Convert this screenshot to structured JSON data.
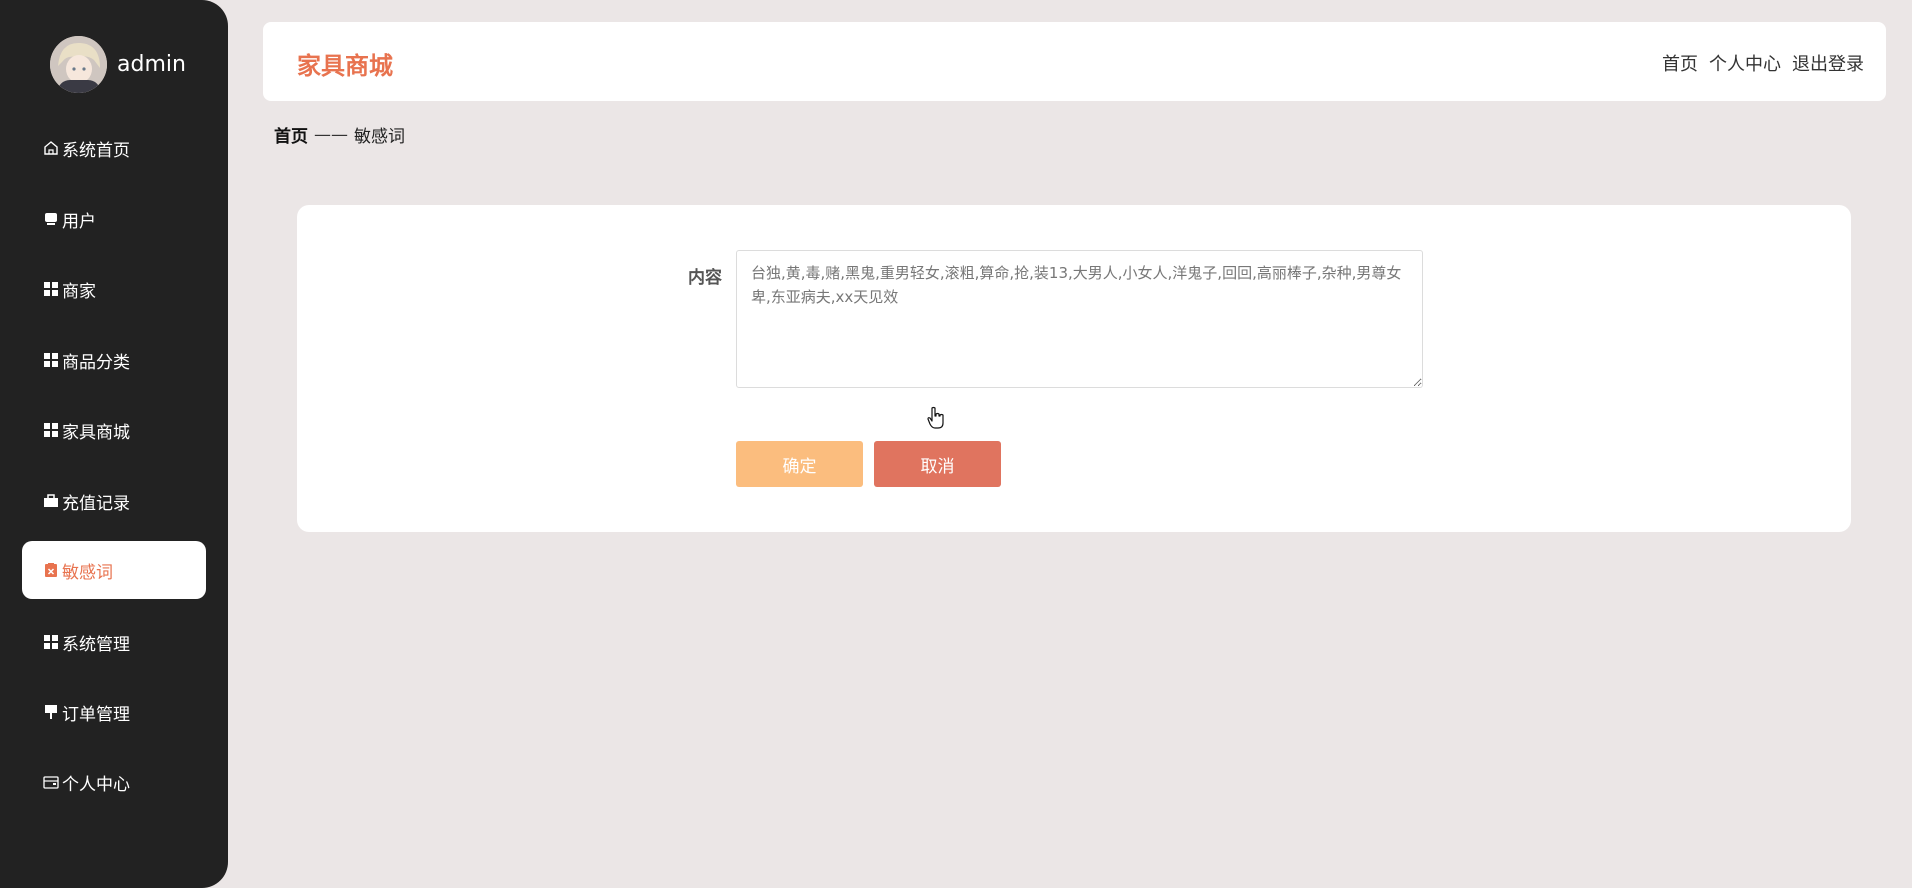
{
  "user": {
    "name": "admin"
  },
  "sidebar": {
    "items": [
      {
        "label": "系统首页",
        "icon": "home-icon",
        "active": false
      },
      {
        "label": "用户",
        "icon": "user-icon",
        "active": false
      },
      {
        "label": "商家",
        "icon": "grid-icon",
        "active": false
      },
      {
        "label": "商品分类",
        "icon": "grid-icon",
        "active": false
      },
      {
        "label": "家具商城",
        "icon": "grid-icon",
        "active": false
      },
      {
        "label": "充值记录",
        "icon": "briefcase-icon",
        "active": false
      },
      {
        "label": "敏感词",
        "icon": "clipboard-x-icon",
        "active": true
      },
      {
        "label": "系统管理",
        "icon": "grid-icon",
        "active": false
      },
      {
        "label": "订单管理",
        "icon": "sign-icon",
        "active": false
      },
      {
        "label": "个人中心",
        "icon": "wallet-icon",
        "active": false
      }
    ]
  },
  "header": {
    "brand": "家具商城",
    "nav": {
      "home": "首页",
      "profile": "个人中心",
      "logout": "退出登录"
    }
  },
  "breadcrumb": {
    "home": "首页",
    "separator": "——",
    "current": "敏感词"
  },
  "form": {
    "content_label": "内容",
    "content_value": "台独,黄,毒,赌,黑鬼,重男轻女,滚粗,算命,抢,装13,大男人,小女人,洋鬼子,回回,高丽棒子,杂种,男尊女卑,东亚病夫,xx天见效",
    "ok_label": "确定",
    "cancel_label": "取消"
  },
  "colors": {
    "accent": "#e8734f",
    "sidebar_bg": "#222222",
    "page_bg": "#ebe6e6",
    "ok_button": "#fbbd7e",
    "cancel_button": "#e0745f"
  }
}
